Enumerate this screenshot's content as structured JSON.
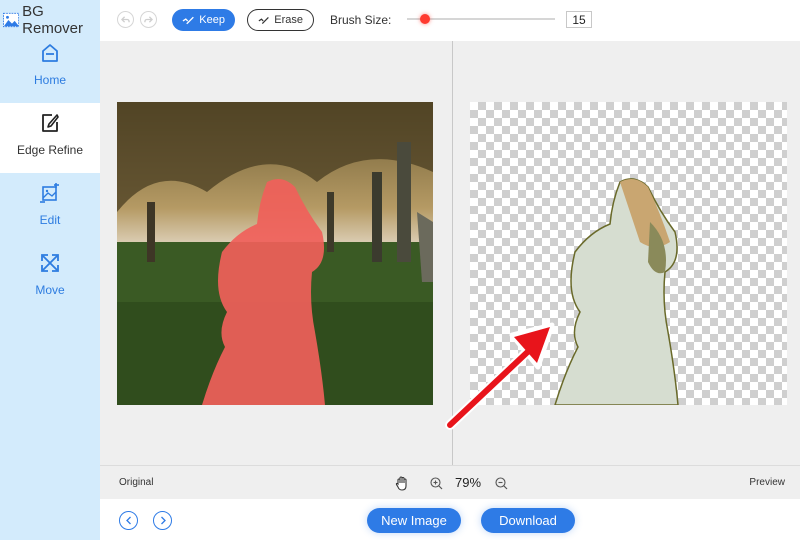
{
  "app": {
    "title": "BG Remover",
    "logo_icon": "image-icon"
  },
  "sidebar": {
    "items": [
      {
        "label": "Home",
        "icon": "home-icon",
        "active": false
      },
      {
        "label": "Edge Refine",
        "icon": "edge-refine-icon",
        "active": true
      },
      {
        "label": "Edit",
        "icon": "edit-image-icon",
        "active": false
      },
      {
        "label": "Move",
        "icon": "move-icon",
        "active": false
      }
    ]
  },
  "toolbar": {
    "undo_icon": "undo-icon",
    "redo_icon": "redo-icon",
    "keep_label": "Keep",
    "erase_label": "Erase",
    "brush_size_label": "Brush Size:",
    "brush_size_value": "15",
    "brush_slider_fraction": 0.12
  },
  "workspace": {
    "original_label": "Original",
    "preview_label": "Preview",
    "zoom_value": "79%"
  },
  "bottom": {
    "new_image_label": "New Image",
    "download_label": "Download"
  },
  "colors": {
    "accent": "#2e7be6",
    "sidebar_bg": "#d3ebfc",
    "highlight_overlay": "#f0605a",
    "slider_thumb": "#ff3b30",
    "annotation_arrow": "#e8141b"
  }
}
